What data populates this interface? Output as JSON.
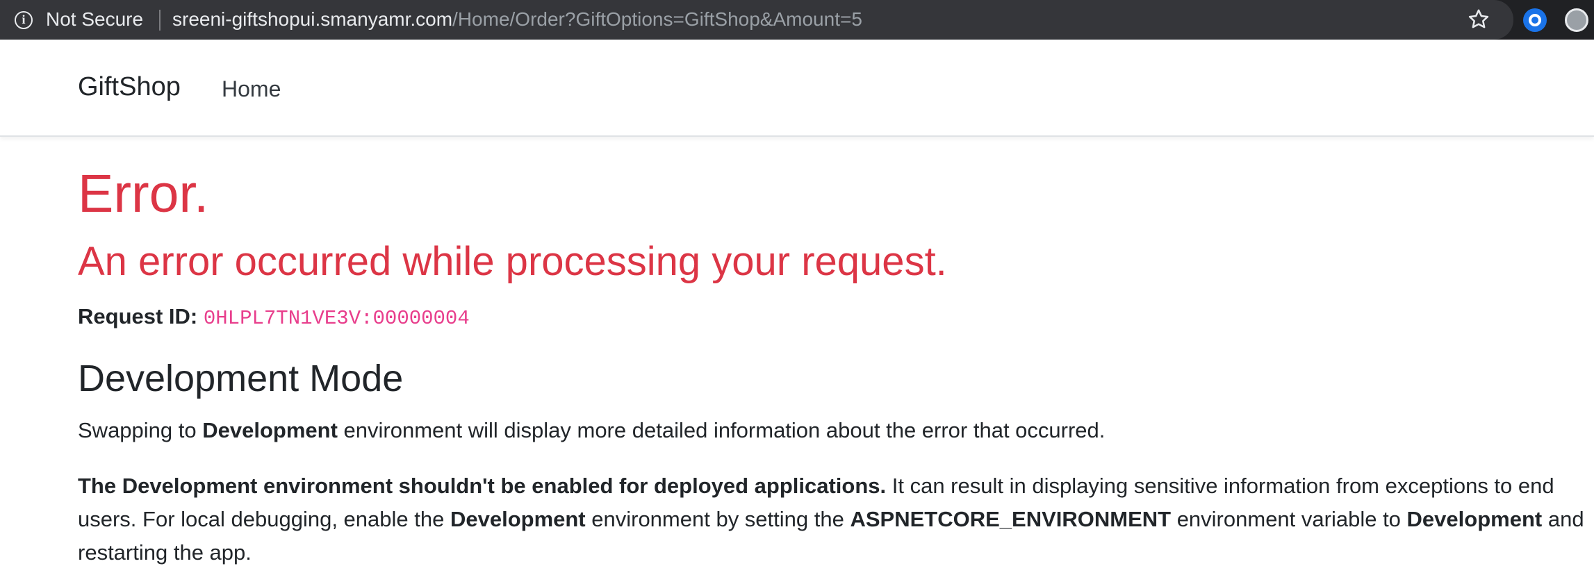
{
  "browser": {
    "security_label": "Not Secure",
    "url_host": "sreeni-giftshopui.smanyamr.com",
    "url_path": "/Home/Order?GiftOptions=GiftShop&Amount=5",
    "icons": [
      "info-icon",
      "bookmark-star-icon",
      "extension-icon",
      "profile-icon"
    ]
  },
  "navbar": {
    "brand": "GiftShop",
    "links": [
      {
        "label": "Home"
      }
    ]
  },
  "error": {
    "title": "Error.",
    "subtitle": "An error occurred while processing your request.",
    "request_id_label": "Request ID:",
    "request_id_value": "0HLPL7TN1VE3V:00000004"
  },
  "dev_mode": {
    "heading": "Development Mode",
    "p1": {
      "t1": "Swapping to ",
      "b1": "Development",
      "t2": " environment will display more detailed information about the error that occurred."
    },
    "p2": {
      "b1": "The Development environment shouldn't be enabled for deployed applications.",
      "t1": " It can result in displaying sensitive information from exceptions to end users. For local debugging, enable the ",
      "b2": "Development",
      "t2": " environment by setting the ",
      "b3": "ASPNETCORE_ENVIRONMENT",
      "t3": " environment variable to ",
      "b4": "Development",
      "t4": " and restarting the app."
    }
  },
  "colors": {
    "error_red": "#dc3545",
    "code_pink": "#e83e8c",
    "chrome_dark": "#35363a",
    "ext_blue": "#1a73e8"
  }
}
